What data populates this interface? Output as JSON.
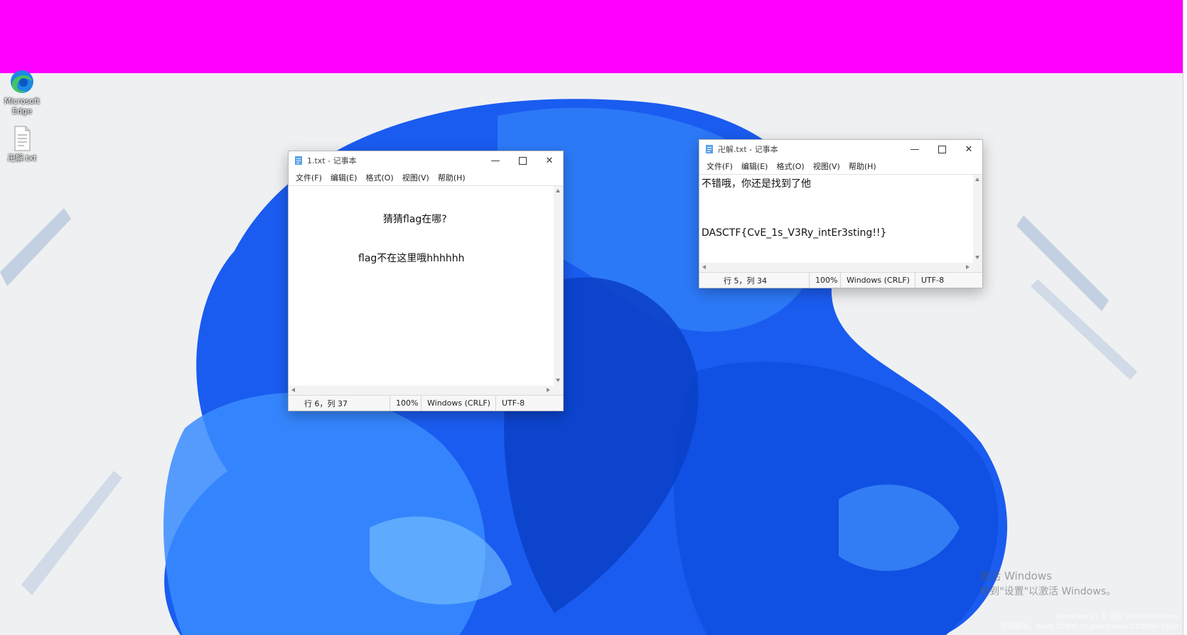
{
  "desktop": {
    "icons": [
      {
        "label": "Microsoft Edge",
        "icon": "edge-icon"
      },
      {
        "label": "卍解.txt",
        "icon": "text-file-icon"
      }
    ],
    "watermark": {
      "line1": "激活 Windows",
      "line2": "转到\"设置\"以激活 Windows。"
    },
    "build": {
      "line1": "Windows 11 专业版 Insider Preview",
      "line2": "评估副本。Build 22000.rs_prerelease.210604-1628"
    },
    "colors": {
      "bar": "#ff00ff",
      "wallpaper_blue": "#1a5cf0"
    }
  },
  "notepad1": {
    "title": "1.txt - 记事本",
    "menu": [
      "文件(F)",
      "编辑(E)",
      "格式(O)",
      "视图(V)",
      "帮助(H)"
    ],
    "lines": [
      "猜猜flag在哪?",
      "flag不在这里哦hhhhhh"
    ],
    "status": {
      "position": "行 6，列 37",
      "zoom": "100%",
      "line_ending": "Windows (CRLF)",
      "encoding": "UTF-8"
    }
  },
  "notepad2": {
    "title": "卍解.txt - 记事本",
    "menu": [
      "文件(F)",
      "编辑(E)",
      "格式(O)",
      "视图(V)",
      "帮助(H)"
    ],
    "lines": [
      "不错哦，你还是找到了他",
      "DASCTF{CvE_1s_V3Ry_intEr3sting!!}"
    ],
    "status": {
      "position": "行 5，列 34",
      "zoom": "100%",
      "line_ending": "Windows (CRLF)",
      "encoding": "UTF-8"
    }
  }
}
